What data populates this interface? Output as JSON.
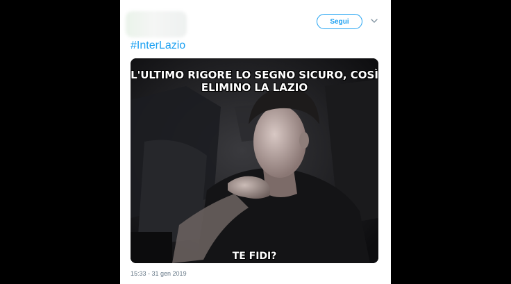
{
  "tweet": {
    "follow_label": "Segui",
    "hashtag": "#InterLazio",
    "timestamp": "15:33 - 31 gen 2019"
  },
  "media": {
    "caption_top_line1": "L'ULTIMO RIGORE LO SEGNO SICURO, COSÌ",
    "caption_top_line2": "ELIMINO LA LAZIO",
    "caption_bottom": "TE FIDI?"
  },
  "colors": {
    "link_blue": "#1da1f2",
    "timestamp_gray": "#657786",
    "page_background": "#000000"
  },
  "icons": [
    "chevron-down-icon"
  ]
}
